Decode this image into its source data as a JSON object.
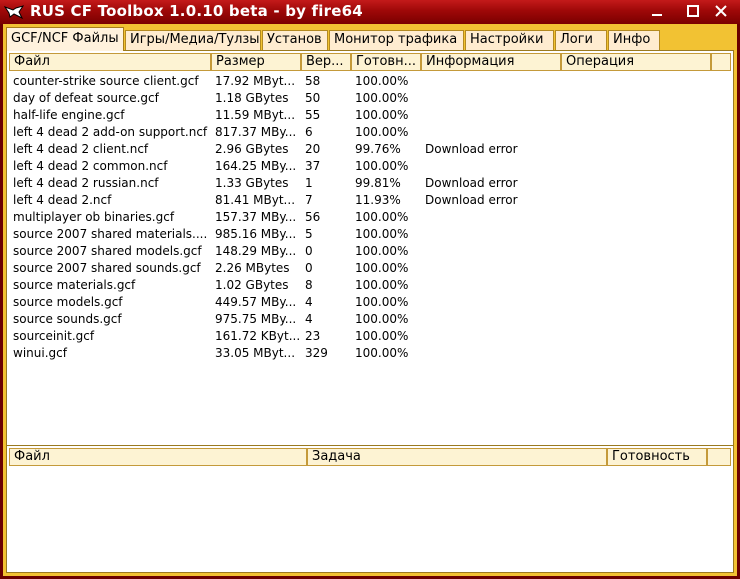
{
  "window": {
    "title": "RUS CF Toolbox 1.0.10 beta - by fire64"
  },
  "tabs": [
    {
      "label": "GCF/NCF Файлы",
      "active": true
    },
    {
      "label": "Игры/Медиа/Тулзы"
    },
    {
      "label": "Установ"
    },
    {
      "label": "Монитор трафика"
    },
    {
      "label": "Настройки"
    },
    {
      "label": "Логи"
    },
    {
      "label": "Инфо"
    }
  ],
  "files_table": {
    "columns": [
      "Файл",
      "Размер",
      "Вер...",
      "Готовн...",
      "Информация",
      "Операция"
    ],
    "rows": [
      {
        "file": "counter-strike source client.gcf",
        "size": "17.92 MByt...",
        "ver": "58",
        "ready": "100.00%",
        "info": "",
        "op": ""
      },
      {
        "file": "day of defeat source.gcf",
        "size": "1.18 GBytes",
        "ver": "50",
        "ready": "100.00%",
        "info": "",
        "op": ""
      },
      {
        "file": "half-life engine.gcf",
        "size": "11.59 MByt...",
        "ver": "55",
        "ready": "100.00%",
        "info": "",
        "op": ""
      },
      {
        "file": "left 4 dead 2 add-on support.ncf",
        "size": "817.37 MBy...",
        "ver": "6",
        "ready": "100.00%",
        "info": "",
        "op": ""
      },
      {
        "file": "left 4 dead 2 client.ncf",
        "size": "2.96 GBytes",
        "ver": "20",
        "ready": "99.76%",
        "info": "Download error",
        "op": ""
      },
      {
        "file": "left 4 dead 2 common.ncf",
        "size": "164.25 MBy...",
        "ver": "37",
        "ready": "100.00%",
        "info": "",
        "op": ""
      },
      {
        "file": "left 4 dead 2 russian.ncf",
        "size": "1.33 GBytes",
        "ver": "1",
        "ready": "99.81%",
        "info": "Download error",
        "op": ""
      },
      {
        "file": "left 4 dead 2.ncf",
        "size": "81.41 MByt...",
        "ver": "7",
        "ready": "11.93%",
        "info": "Download error",
        "op": ""
      },
      {
        "file": "multiplayer ob binaries.gcf",
        "size": "157.37 MBy...",
        "ver": "56",
        "ready": "100.00%",
        "info": "",
        "op": ""
      },
      {
        "file": "source 2007 shared materials....",
        "size": "985.16 MBy...",
        "ver": "5",
        "ready": "100.00%",
        "info": "",
        "op": ""
      },
      {
        "file": "source 2007 shared models.gcf",
        "size": "148.29 MBy...",
        "ver": "0",
        "ready": "100.00%",
        "info": "",
        "op": ""
      },
      {
        "file": "source 2007 shared sounds.gcf",
        "size": "2.26 MBytes",
        "ver": "0",
        "ready": "100.00%",
        "info": "",
        "op": ""
      },
      {
        "file": "source materials.gcf",
        "size": "1.02 GBytes",
        "ver": "8",
        "ready": "100.00%",
        "info": "",
        "op": ""
      },
      {
        "file": "source models.gcf",
        "size": "449.57 MBy...",
        "ver": "4",
        "ready": "100.00%",
        "info": "",
        "op": ""
      },
      {
        "file": "source sounds.gcf",
        "size": "975.75 MBy...",
        "ver": "4",
        "ready": "100.00%",
        "info": "",
        "op": ""
      },
      {
        "file": "sourceinit.gcf",
        "size": "161.72 KByt...",
        "ver": "23",
        "ready": "100.00%",
        "info": "",
        "op": ""
      },
      {
        "file": "winui.gcf",
        "size": "33.05 MByt...",
        "ver": "329",
        "ready": "100.00%",
        "info": "",
        "op": ""
      }
    ]
  },
  "tasks_table": {
    "columns": [
      "Файл",
      "Задача",
      "Готовность"
    ]
  },
  "icons": {
    "app": "cf-logo-icon",
    "minimize": "minimize-icon",
    "maximize": "maximize-icon",
    "close": "close-icon"
  },
  "colors": {
    "titlebar": "#9e0808",
    "frame": "#6a0000",
    "client": "#f2c233",
    "tab_bg": "#ffecd0",
    "header_bg": "#fdf3d3"
  }
}
